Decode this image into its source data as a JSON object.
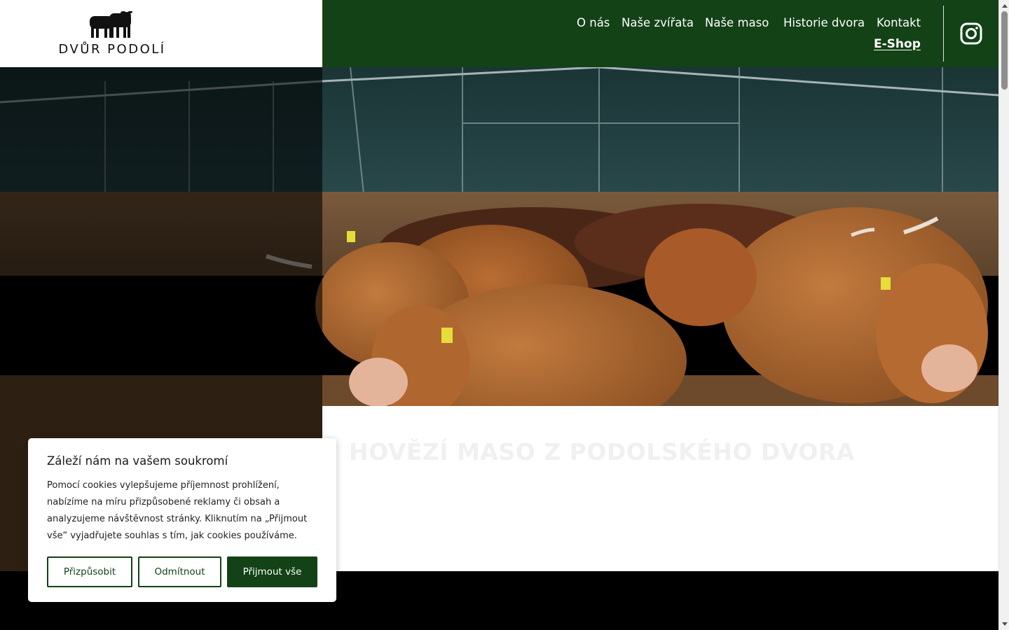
{
  "header": {
    "logo_text": "DVŮR PODOLÍ",
    "nav": [
      {
        "label": "O nás"
      },
      {
        "label": "Naše zvířata"
      },
      {
        "label": "Naše maso"
      },
      {
        "label": "Historie dvora"
      },
      {
        "label": "Kontakt"
      }
    ],
    "eshop_label": "E-Shop",
    "social_icon": "instagram-icon"
  },
  "hero": {
    "title": "HOVĚZÍ MASO Z PODOLSKÉHO DVORA",
    "text": ""
  },
  "cookie": {
    "title": "Záleží nám na vašem soukromí",
    "text": "Pomocí cookies vylepšujeme příjemnost prohlížení, nabízíme na míru přizpůsobené reklamy či obsah a analyzujeme návštěvnost stránky. Kliknutím na „Přijmout vše“ vyjadřujete souhlas s tím, jak cookies používáme.",
    "buttons": {
      "customize": "Přizpůsobit",
      "reject": "Odmítnout",
      "accept": "Přijmout vše"
    }
  },
  "colors": {
    "brand_green": "#124216",
    "white": "#ffffff",
    "black": "#000000"
  }
}
